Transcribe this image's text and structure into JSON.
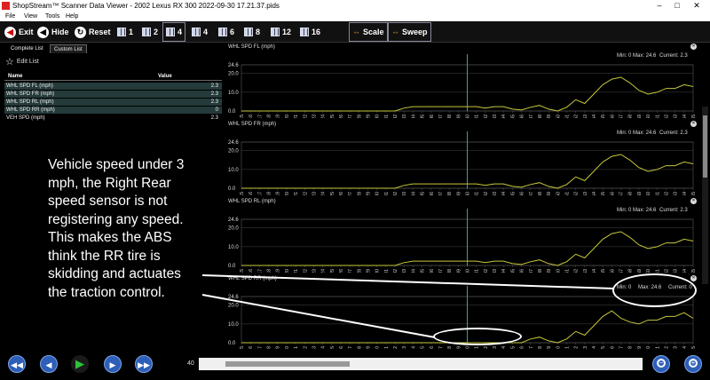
{
  "window": {
    "title": "ShopStream™ Scanner Data Viewer - 2002 Lexus RX 300 2022-09-30 17.21.37.pids"
  },
  "menu": [
    "File",
    "View",
    "Tools",
    "Help"
  ],
  "toolbar": {
    "exit": "Exit",
    "hide": "Hide",
    "reset": "Reset",
    "grid_counts": [
      "1",
      "2",
      "4",
      "4",
      "6",
      "8",
      "12",
      "16"
    ],
    "selected_grid_index": 2,
    "scale": "Scale",
    "sweep": "Sweep"
  },
  "leftpanel": {
    "tabs": [
      "Complete List",
      "Custom List"
    ],
    "edit_list": "Edit List",
    "col_name": "Name",
    "col_value": "Value",
    "rows": [
      {
        "name": "WHL SPD FL (mph)",
        "value": "2.3",
        "highlight": true
      },
      {
        "name": "WHL SPD FR (mph)",
        "value": "2.3",
        "highlight": true
      },
      {
        "name": "WHL SPD RL (mph)",
        "value": "2.3",
        "highlight": true
      },
      {
        "name": "WHL SPD RR (mph)",
        "value": "0",
        "highlight": true
      },
      {
        "name": "VEH SPD (mph)",
        "value": "2.3",
        "highlight": false
      }
    ]
  },
  "annotation": "Vehicle speed under 3 mph, the Right Rear speed sensor is not registering any speed. This makes the ABS think the RR tire is skidding and actuates the traction control.",
  "colors": {
    "trace": "#c8c83a",
    "cursor": "#3aa0a0",
    "grid": "#555555"
  },
  "chart_data": [
    {
      "type": "line",
      "title": "WHL SPD FL (mph)",
      "min_label": "Min: 0",
      "max_label": "Max: 24.6",
      "current_label": "Current: 2.3",
      "ylim": [
        0,
        24.6
      ],
      "yticks": [
        "24.6",
        "20.0",
        "10.0",
        "0.0"
      ],
      "x": [
        15,
        16,
        17,
        18,
        19,
        20,
        21,
        22,
        23,
        24,
        25,
        26,
        27,
        28,
        29,
        30,
        31,
        32,
        33,
        34,
        35,
        36,
        37,
        38,
        39,
        40,
        41,
        42,
        43,
        44,
        45,
        46,
        47,
        48,
        49,
        50,
        51,
        52,
        53,
        54,
        55,
        56,
        57,
        58,
        59,
        60,
        61,
        62,
        63,
        64,
        65
      ],
      "values": [
        0,
        0,
        0,
        0,
        0,
        0,
        0,
        0,
        0,
        0,
        0,
        0,
        0,
        0,
        0,
        0,
        0,
        0,
        1.5,
        2.3,
        2.3,
        2.3,
        2.3,
        2.3,
        2.3,
        2.3,
        2.3,
        1.5,
        2.3,
        2.3,
        1,
        0.5,
        2,
        3,
        1,
        0,
        2,
        6,
        4,
        9,
        14,
        17,
        18,
        15,
        11,
        9,
        10,
        12,
        12,
        14,
        13
      ]
    },
    {
      "type": "line",
      "title": "WHL SPD FR (mph)",
      "min_label": "Min: 0",
      "max_label": "Max: 24.6",
      "current_label": "Current: 2.3",
      "ylim": [
        0,
        24.6
      ],
      "yticks": [
        "24.6",
        "20.0",
        "10.0",
        "0.0"
      ],
      "x": [
        15,
        16,
        17,
        18,
        19,
        20,
        21,
        22,
        23,
        24,
        25,
        26,
        27,
        28,
        29,
        30,
        31,
        32,
        33,
        34,
        35,
        36,
        37,
        38,
        39,
        40,
        41,
        42,
        43,
        44,
        45,
        46,
        47,
        48,
        49,
        50,
        51,
        52,
        53,
        54,
        55,
        56,
        57,
        58,
        59,
        60,
        61,
        62,
        63,
        64,
        65
      ],
      "values": [
        0,
        0,
        0,
        0,
        0,
        0,
        0,
        0,
        0,
        0,
        0,
        0,
        0,
        0,
        0,
        0,
        0,
        0,
        1.5,
        2.3,
        2.3,
        2.3,
        2.3,
        2.3,
        2.3,
        2.3,
        2.3,
        1.5,
        2.3,
        2.3,
        1,
        0.5,
        2,
        3,
        1,
        0,
        2,
        6,
        4,
        9,
        14,
        17,
        18,
        15,
        11,
        9,
        10,
        12,
        12,
        14,
        13
      ]
    },
    {
      "type": "line",
      "title": "WHL SPD RL (mph)",
      "min_label": "Min: 0",
      "max_label": "Max: 24.6",
      "current_label": "Current: 2.3",
      "ylim": [
        0,
        24.6
      ],
      "yticks": [
        "24.6",
        "20.0",
        "10.0",
        "0.0"
      ],
      "x": [
        15,
        16,
        17,
        18,
        19,
        20,
        21,
        22,
        23,
        24,
        25,
        26,
        27,
        28,
        29,
        30,
        31,
        32,
        33,
        34,
        35,
        36,
        37,
        38,
        39,
        40,
        41,
        42,
        43,
        44,
        45,
        46,
        47,
        48,
        49,
        50,
        51,
        52,
        53,
        54,
        55,
        56,
        57,
        58,
        59,
        60,
        61,
        62,
        63,
        64,
        65
      ],
      "values": [
        0,
        0,
        0,
        0,
        0,
        0,
        0,
        0,
        0,
        0,
        0,
        0,
        0,
        0,
        0,
        0,
        0,
        0,
        1.5,
        2.3,
        2.3,
        2.3,
        2.3,
        2.3,
        2.3,
        2.3,
        2.3,
        1.5,
        2.3,
        2.3,
        1,
        0.5,
        2,
        3,
        1,
        0,
        2,
        6,
        4,
        9,
        14,
        17,
        18,
        15,
        11,
        9,
        10,
        12,
        12,
        14,
        13
      ]
    },
    {
      "type": "line",
      "title": "WHL SPD RR (mph)",
      "min_label": "Min: 0",
      "max_label": "Max: 24.6",
      "current_label": "Current: 0",
      "ylim": [
        0,
        24.6
      ],
      "yticks": [
        "24.6",
        "20.0",
        "10.0",
        "0.0"
      ],
      "x": [
        15,
        16,
        17,
        18,
        19,
        20,
        21,
        22,
        23,
        24,
        25,
        26,
        27,
        28,
        29,
        30,
        31,
        32,
        33,
        34,
        35,
        36,
        37,
        38,
        39,
        40,
        41,
        42,
        43,
        44,
        45,
        46,
        47,
        48,
        49,
        50,
        51,
        52,
        53,
        54,
        55,
        56,
        57,
        58,
        59,
        60,
        61,
        62,
        63,
        64,
        65
      ],
      "values": [
        0,
        0,
        0,
        0,
        0,
        0,
        0,
        0,
        0,
        0,
        0,
        0,
        0,
        0,
        0,
        0,
        0,
        0,
        0,
        0,
        0,
        0,
        0,
        0,
        0,
        0,
        0,
        0,
        0,
        0,
        0,
        0,
        2,
        3,
        1,
        0,
        2,
        6,
        4,
        9,
        14,
        17,
        13,
        11,
        10,
        12,
        12,
        14,
        14,
        16,
        13
      ]
    }
  ],
  "bottombar": {
    "position": "40",
    "scroll_fraction": 0.06
  }
}
